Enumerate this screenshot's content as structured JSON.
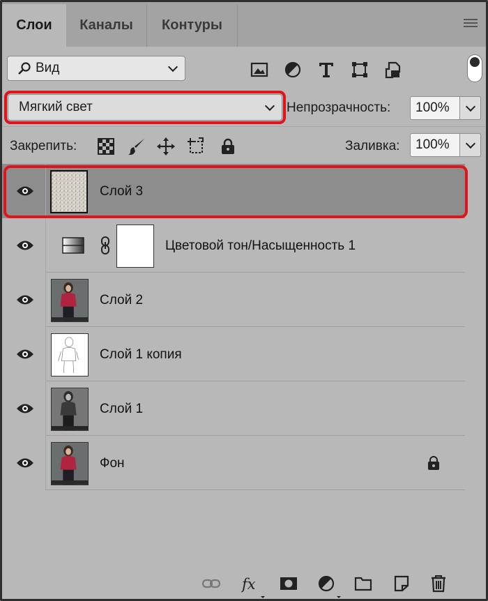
{
  "tabs": [
    {
      "label": "Слои",
      "active": true
    },
    {
      "label": "Каналы",
      "active": false
    },
    {
      "label": "Контуры",
      "active": false
    }
  ],
  "filter": {
    "kind_label": "Вид",
    "icons": [
      "image-filter-icon",
      "adjustment-filter-icon",
      "type-filter-icon",
      "shape-filter-icon",
      "smart-object-filter-icon"
    ]
  },
  "blend": {
    "mode": "Мягкий свет",
    "opacity_label": "Непрозрачность:",
    "opacity_value": "100%"
  },
  "lock": {
    "label": "Закрепить:",
    "icons": [
      "lock-transparent-pixels-icon",
      "lock-image-pixels-icon",
      "lock-position-icon",
      "lock-artboard-icon",
      "lock-all-icon"
    ],
    "fill_label": "Заливка:",
    "fill_value": "100%"
  },
  "layers": [
    {
      "name": "Слой 3",
      "selected": true,
      "thumb": "texture"
    },
    {
      "name": "Цветовой тон/Насыщенность 1",
      "selected": false,
      "thumb": "adjustment"
    },
    {
      "name": "Слой 2",
      "selected": false,
      "thumb": "photo-color"
    },
    {
      "name": "Слой 1 копия",
      "selected": false,
      "thumb": "sketch"
    },
    {
      "name": "Слой 1",
      "selected": false,
      "thumb": "photo-bw"
    },
    {
      "name": "Фон",
      "selected": false,
      "thumb": "photo-color",
      "locked": true
    }
  ],
  "bottom_icons": [
    "link-layers-icon",
    "fx-icon",
    "add-mask-icon",
    "new-adjustment-icon",
    "new-group-icon",
    "new-layer-icon",
    "delete-layer-icon"
  ],
  "colors": {
    "panel_bg": "#b8b8b8",
    "selected_row": "#8d8d8d",
    "highlight": "#e1141a"
  }
}
